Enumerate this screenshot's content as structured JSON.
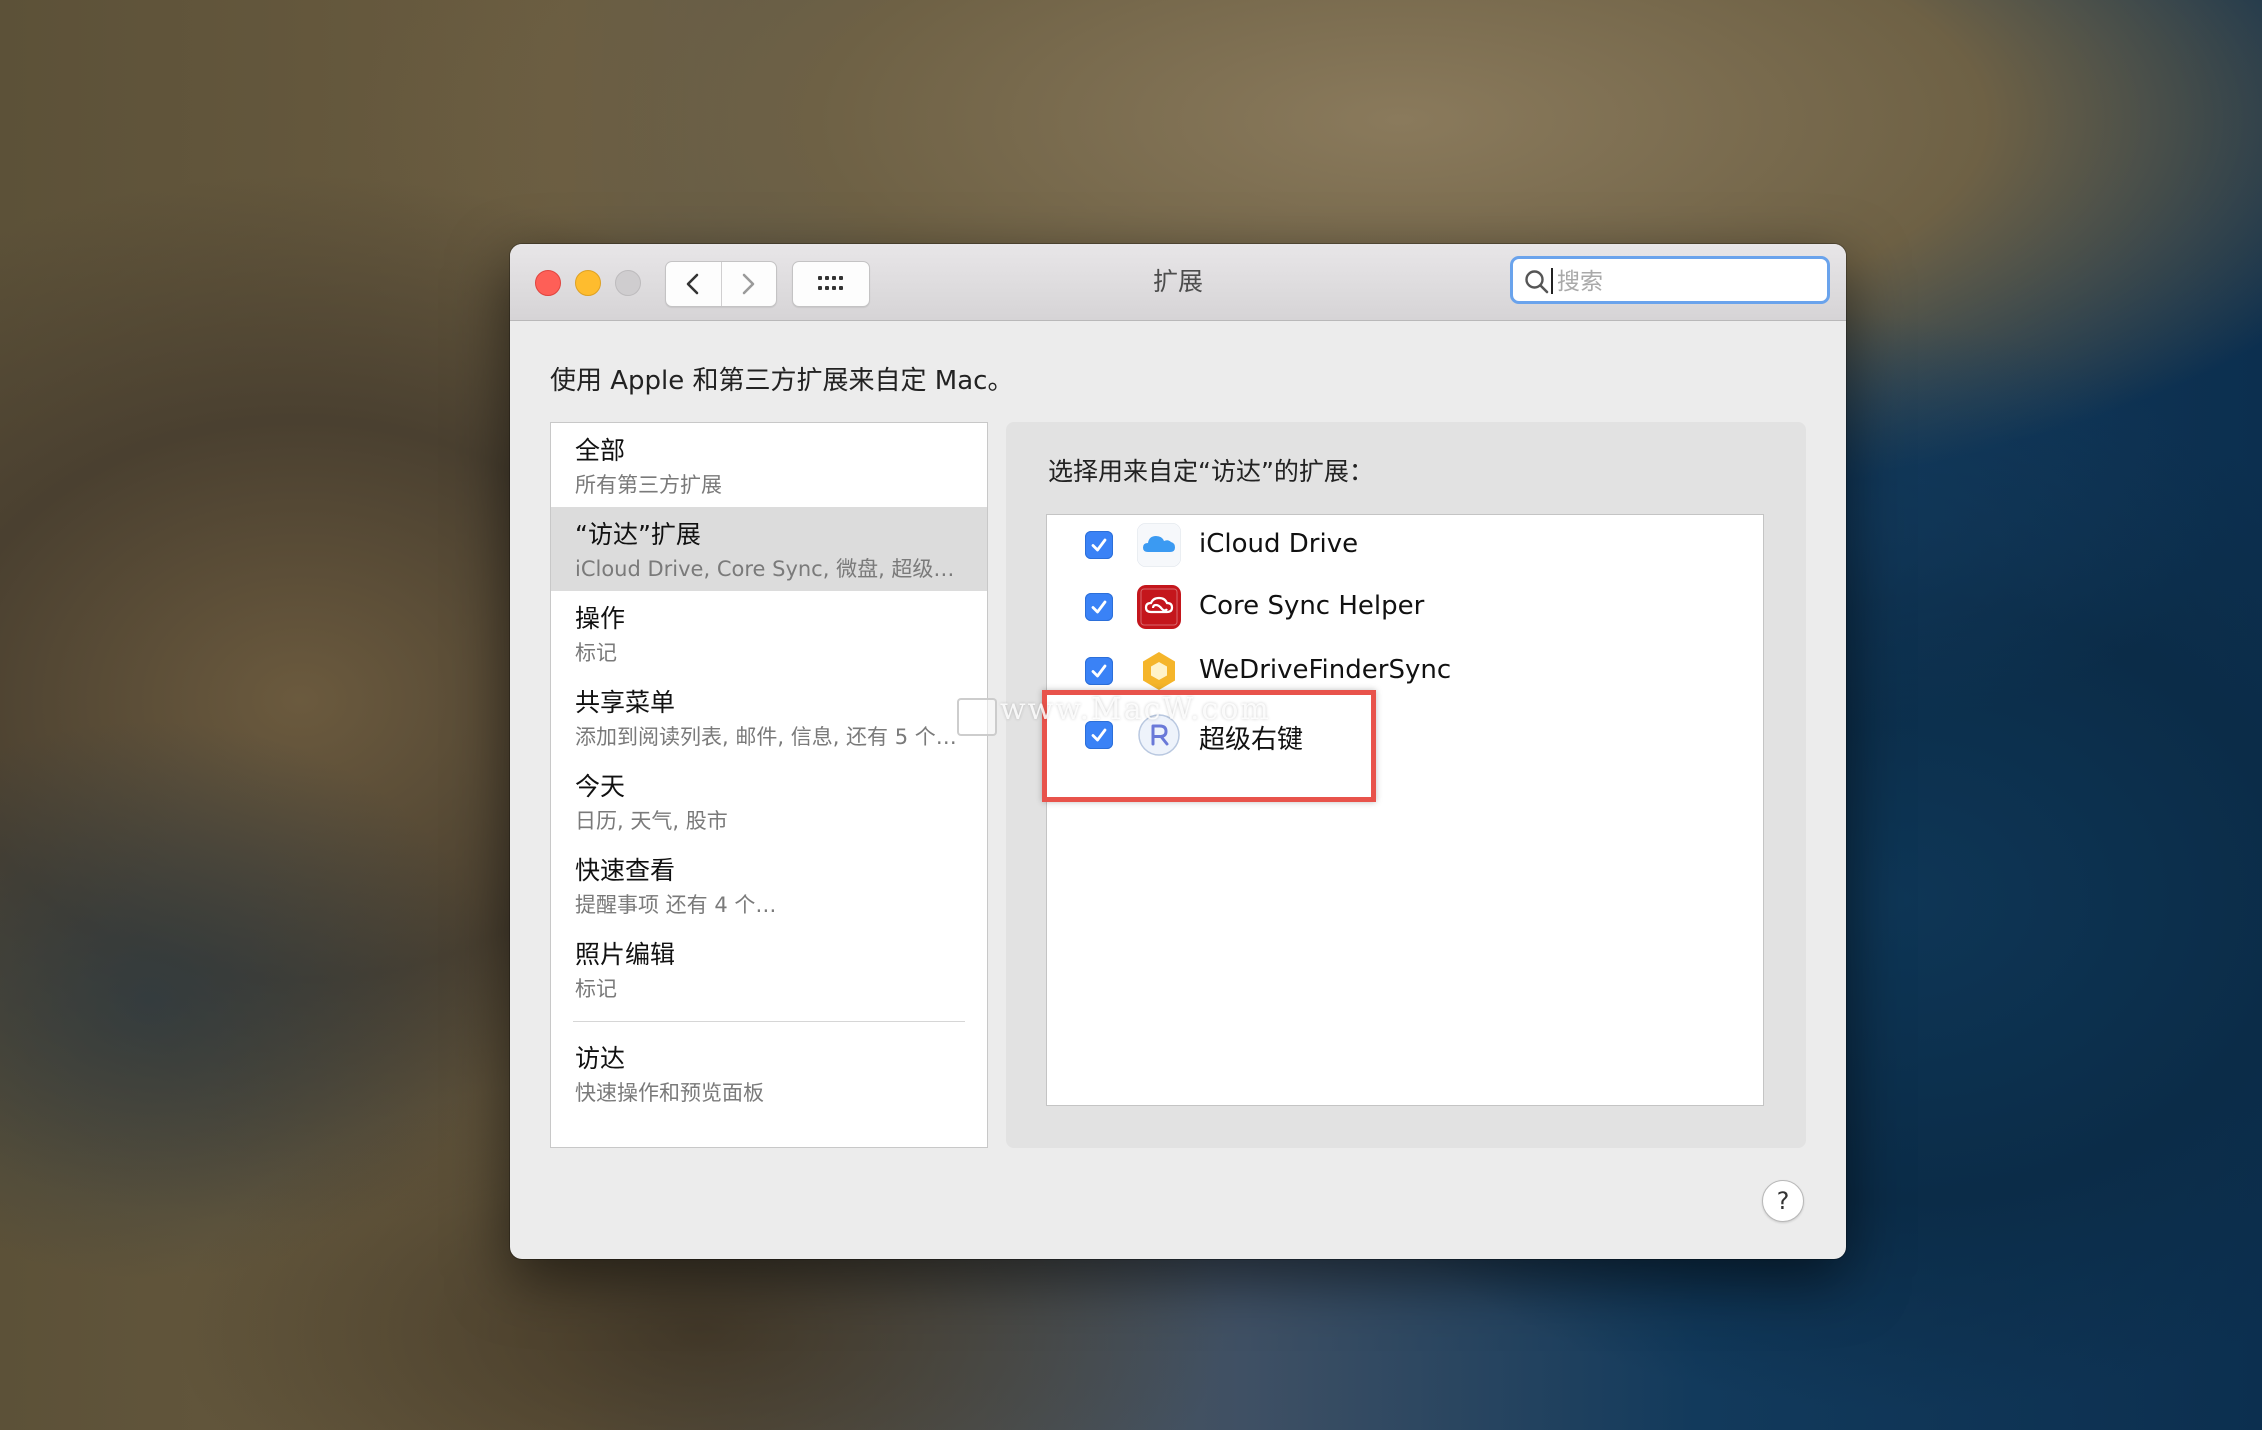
{
  "window": {
    "title": "扩展",
    "search_placeholder": "搜索",
    "description": "使用 Apple 和第三方扩展来自定 Mac。"
  },
  "sidebar": {
    "items": [
      {
        "title": "全部",
        "subtitle": "所有第三方扩展"
      },
      {
        "title": "“访达”扩展",
        "subtitle": "iCloud Drive, Core Sync, 微盘, 超级…",
        "selected": true
      },
      {
        "title": "操作",
        "subtitle": "标记"
      },
      {
        "title": "共享菜单",
        "subtitle": "添加到阅读列表, 邮件, 信息, 还有 5 个…"
      },
      {
        "title": "今天",
        "subtitle": "日历, 天气, 股市"
      },
      {
        "title": "快速查看",
        "subtitle": "提醒事项 还有 4 个…"
      },
      {
        "title": "照片编辑",
        "subtitle": "标记"
      },
      {
        "title": "访达",
        "subtitle": "快速操作和预览面板"
      }
    ]
  },
  "panel": {
    "title": "选择用来自定“访达”的扩展：",
    "extensions": [
      {
        "label": "iCloud Drive",
        "checked": true,
        "icon": "icloud-icon"
      },
      {
        "label": "Core Sync Helper",
        "checked": true,
        "icon": "creative-cloud-icon"
      },
      {
        "label": "WeDriveFinderSync",
        "checked": true,
        "icon": "wedrive-icon"
      },
      {
        "label": "超级右键",
        "checked": true,
        "icon": "super-right-click-icon"
      }
    ]
  },
  "watermark": "www.MacW.com",
  "help_label": "?",
  "colors": {
    "accent": "#3a82f6",
    "highlight": "#e8534b"
  }
}
